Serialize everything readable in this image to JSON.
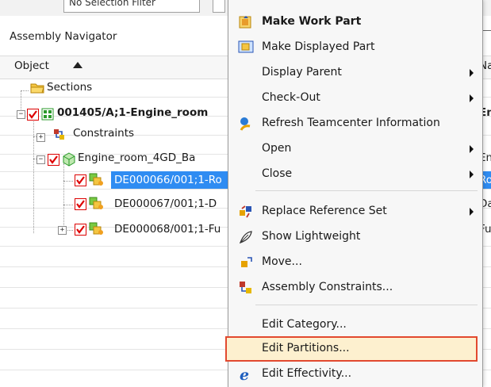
{
  "toolbar": {
    "filter_text": "No Selection Filter"
  },
  "navigator": {
    "title": "Assembly Navigator",
    "column_header": "Object",
    "right_header_peek": "Na"
  },
  "tree": {
    "sections": "Sections",
    "root": "001405/A;1-Engine_room",
    "constraints": "Constraints",
    "subassembly": "Engine_room_4GD_Ba",
    "parts": [
      {
        "label": "DE000066/001;1-Ro",
        "selected": true
      },
      {
        "label": "DE000067/001;1-D",
        "selected": false
      },
      {
        "label": "DE000068/001;1-Fu",
        "selected": false
      }
    ]
  },
  "right_column": {
    "root": "En",
    "subassembly": "En",
    "part1": "Ro",
    "part2": "Da",
    "part3": "Fu"
  },
  "context_menu": {
    "items": [
      {
        "label": "Make Work Part",
        "bold": true,
        "icon": "work-part-icon"
      },
      {
        "label": "Make Displayed Part",
        "icon": "displayed-part-icon"
      },
      {
        "label": "Display Parent",
        "submenu": true
      },
      {
        "label": "Check-Out",
        "submenu": true
      },
      {
        "label": "Refresh Teamcenter Information",
        "icon": "teamcenter-refresh-icon"
      },
      {
        "label": "Open",
        "submenu": true
      },
      {
        "label": "Close",
        "submenu": true
      },
      {
        "label": "Replace Reference Set",
        "submenu": true,
        "icon": "replace-reference-set-icon"
      },
      {
        "label": "Show Lightweight",
        "icon": "lightweight-feather-icon"
      },
      {
        "label": "Move...",
        "icon": "move-icon"
      },
      {
        "label": "Assembly Constraints...",
        "icon": "assembly-constraints-icon"
      },
      {
        "label": "Edit Category..."
      },
      {
        "label": "Edit Partitions...",
        "highlighted": true
      },
      {
        "label": "Edit Effectivity...",
        "icon": "effectivity-e-icon"
      }
    ]
  },
  "colors": {
    "selection": "#2f8cf2",
    "highlight_border": "#e2492f",
    "checkbox_red": "#dd0000"
  }
}
